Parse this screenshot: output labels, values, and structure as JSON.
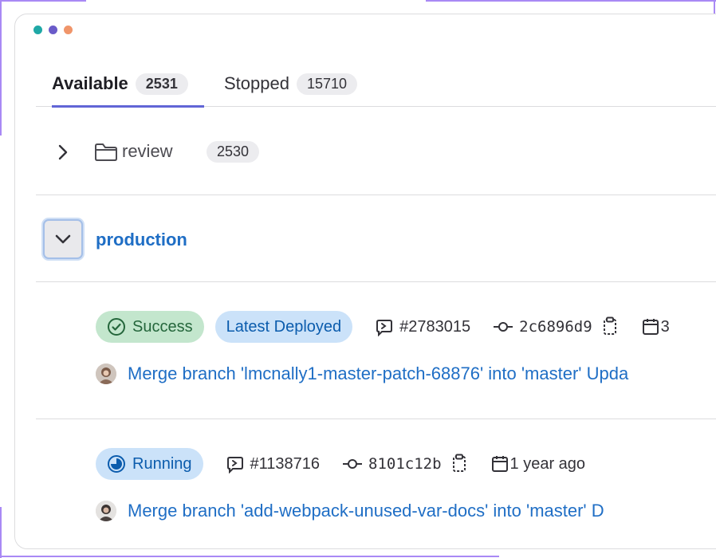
{
  "colors": {
    "frame": "#a989f5",
    "tab_underline": "#6165d6",
    "link": "#1f6ec5",
    "success_bg": "#c3e6cd",
    "info_bg": "#cbe2f9"
  },
  "window_dots": [
    "#1fa8a6",
    "#6a5bc9",
    "#f0956a"
  ],
  "tabs": [
    {
      "label": "Available",
      "count": "2531",
      "active": true
    },
    {
      "label": "Stopped",
      "count": "15710",
      "active": false
    }
  ],
  "folder": {
    "icon": "chevron-right-icon",
    "folder_icon": "folder-icon",
    "name": "review",
    "count": "2530"
  },
  "environment": {
    "toggle_icon": "chevron-down-icon",
    "name": "production"
  },
  "deployments": [
    {
      "status": "Success",
      "status_icon": "check-circle-icon",
      "tag": "Latest Deployed",
      "pipeline": "#2783015",
      "commit_sha": "2c6896d9",
      "date": "3",
      "commit_message": "Merge branch 'lmcnally1-master-patch-68876' into 'master' Upda"
    },
    {
      "status": "Running",
      "status_icon": "running-circle-icon",
      "pipeline": "#1138716",
      "commit_sha": "8101c12b",
      "date": "1 year ago",
      "commit_message": "Merge branch 'add-webpack-unused-var-docs' into 'master' D"
    }
  ]
}
